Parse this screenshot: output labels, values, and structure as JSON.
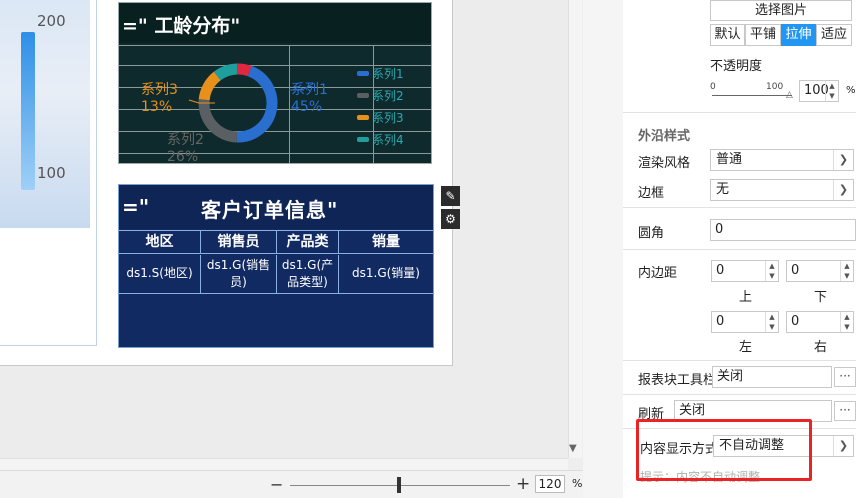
{
  "map_legend": {
    "max": "200",
    "min": "100"
  },
  "chart": {
    "title": "=\" 工龄分布\"",
    "slices": [
      {
        "name": "系列1",
        "pct": "45%",
        "color": "#2a6fd0"
      },
      {
        "name": "系列2",
        "pct": "26%",
        "color": "#5a5f63"
      },
      {
        "name": "系列3",
        "pct": "13%",
        "color": "#e8901c"
      },
      {
        "name": "系列4",
        "pct": "",
        "color": "#1f9e9e"
      }
    ],
    "legend": [
      "系列1",
      "系列2",
      "系列3",
      "系列4"
    ],
    "extra_slice_color": "#e02840"
  },
  "table": {
    "title_prefix": "=\"",
    "title": "客户订单信息\"",
    "headers": [
      "地区",
      "销售员",
      "产品类",
      "销量"
    ],
    "cells": [
      "ds1.S(地区)",
      "ds1.G(销售员)",
      "ds1.G(产品类型)",
      "ds1.G(销量)"
    ]
  },
  "tools": {
    "edit_icon": "edit-icon",
    "settings_icon": "gear-icon"
  },
  "zoom": {
    "minus": "−",
    "plus": "+",
    "value": "120",
    "unit": "%"
  },
  "settings": {
    "select_image_button": "选择图片",
    "fill_modes": [
      "默认",
      "平铺",
      "拉伸",
      "适应"
    ],
    "fill_active": "拉伸",
    "opacity_label": "不透明度",
    "opacity_slider_min": "0",
    "opacity_slider_max": "100",
    "opacity_value": "100",
    "opacity_unit": "%",
    "section_outer_style": "外沿样式",
    "render_style_label": "渲染风格",
    "render_style_value": "普通",
    "border_label": "边框",
    "border_value": "无",
    "radius_label": "圆角",
    "radius_value": "0",
    "padding_label": "内边距",
    "padding_top": "0",
    "padding_bottom": "0",
    "padding_left": "0",
    "padding_right": "0",
    "padding_top_label": "上",
    "padding_bottom_label": "下",
    "padding_left_label": "左",
    "padding_right_label": "右",
    "toolbar_label": "报表块工具栏",
    "toolbar_value": "关闭",
    "refresh_label": "刷新",
    "refresh_value": "关闭",
    "content_display_label": "内容显示方式",
    "content_display_value": "不自动调整",
    "hint_text": "提示：内容不自动调整"
  }
}
